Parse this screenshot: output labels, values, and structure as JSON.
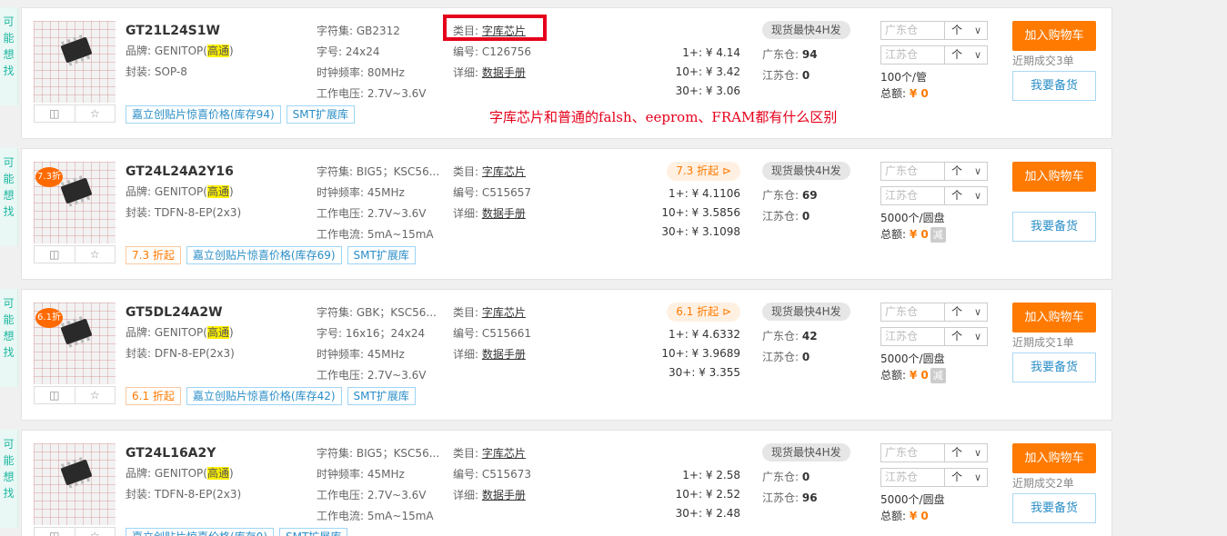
{
  "side_label": [
    "可",
    "能",
    "想",
    "找"
  ],
  "overlay": {
    "note": "字库芯片和普通的falsh、eeprom、FRAM都有什么区别"
  },
  "colors": {
    "accent": "#ff7a00",
    "link": "#2a8ec7",
    "mark": "#e5001b"
  },
  "icons": {
    "compare": "compare-icon",
    "favorite": "star-icon",
    "discount": "tag-icon"
  },
  "products": [
    {
      "name": "GT21L24S1W",
      "brand_label": "品牌: GENITOP(",
      "brand_hl": "高通",
      "brand_end": ")",
      "package": "封装: SOP-8",
      "spec1": "字符集: GB2312",
      "spec2": "字号: 24x24",
      "spec3": "时钟频率: 80MHz",
      "spec4": "工作电压: 2.7V~3.6V",
      "cat_label": "类目:",
      "cat": "字库芯片",
      "code": "编号: C126756",
      "detail_label": "详细:",
      "detail": "数据手册",
      "discount_tag": "",
      "prices": [
        "1+: ¥ 4.14",
        "10+: ¥ 3.42",
        "30+: ¥ 3.06"
      ],
      "fast": "现货最快4H发",
      "gd_label": "广东仓:",
      "gd": "94",
      "js_label": "江苏仓:",
      "js": "0",
      "wh1": "广东仓",
      "wh2": "江苏仓",
      "unit": "个",
      "pack": "100个/管",
      "total_label": "总额:",
      "total": "¥ 0",
      "cart": "加入购物车",
      "recent": "近期成交3单",
      "backup": "我要备货",
      "tag1": "嘉立创贴片惊喜价格(库存94)",
      "tag2": "SMT扩展库"
    },
    {
      "name": "GT24L24A2Y16",
      "brand_label": "品牌: GENITOP(",
      "brand_hl": "高通",
      "brand_end": ")",
      "package": "封装: TDFN-8-EP(2x3)",
      "spec1": "字符集: BIG5；KSC56...",
      "spec2": "时钟频率: 45MHz",
      "spec3": "工作电压: 2.7V~3.6V",
      "spec4": "工作电流: 5mA~15mA",
      "cat_label": "类目:",
      "cat": "字库芯片",
      "code": "编号: C515657",
      "detail_label": "详细:",
      "detail": "数据手册",
      "discount_tag": "7.3 折起",
      "thumb_disc": "7.3折",
      "prices": [
        "1+: ¥ 4.1106",
        "10+: ¥ 3.5856",
        "30+: ¥ 3.1098"
      ],
      "fast": "现货最快4H发",
      "gd_label": "广东仓:",
      "gd": "69",
      "js_label": "江苏仓:",
      "js": "0",
      "wh1": "广东仓",
      "wh2": "江苏仓",
      "unit": "个",
      "pack": "5000个/圆盘",
      "total_label": "总额:",
      "total": "¥ 0",
      "jian": "减",
      "cart": "加入购物车",
      "recent": "",
      "backup": "我要备货",
      "tag0": "7.3 折起",
      "tag1": "嘉立创贴片惊喜价格(库存69)",
      "tag2": "SMT扩展库"
    },
    {
      "name": "GT5DL24A2W",
      "brand_label": "品牌: GENITOP(",
      "brand_hl": "高通",
      "brand_end": ")",
      "package": "封装: DFN-8-EP(2x3)",
      "spec1": "字符集: GBK；KSC56...",
      "spec2": "字号: 16x16；24x24",
      "spec3": "时钟频率: 45MHz",
      "spec4": "工作电压: 2.7V~3.6V",
      "cat_label": "类目:",
      "cat": "字库芯片",
      "code": "编号: C515661",
      "detail_label": "详细:",
      "detail": "数据手册",
      "discount_tag": "6.1 折起",
      "thumb_disc": "6.1折",
      "prices": [
        "1+: ¥ 4.6332",
        "10+: ¥ 3.9689",
        "30+: ¥ 3.355"
      ],
      "fast": "现货最快4H发",
      "gd_label": "广东仓:",
      "gd": "42",
      "js_label": "江苏仓:",
      "js": "0",
      "wh1": "广东仓",
      "wh2": "江苏仓",
      "unit": "个",
      "pack": "5000个/圆盘",
      "total_label": "总额:",
      "total": "¥ 0",
      "jian": "减",
      "cart": "加入购物车",
      "recent": "近期成交1单",
      "backup": "我要备货",
      "tag0": "6.1 折起",
      "tag1": "嘉立创贴片惊喜价格(库存42)",
      "tag2": "SMT扩展库"
    },
    {
      "name": "GT24L16A2Y",
      "brand_label": "品牌: GENITOP(",
      "brand_hl": "高通",
      "brand_end": ")",
      "package": "封装: TDFN-8-EP(2x3)",
      "spec1": "字符集: BIG5；KSC56...",
      "spec2": "时钟频率: 45MHz",
      "spec3": "工作电压: 2.7V~3.6V",
      "spec4": "工作电流: 5mA~15mA",
      "cat_label": "类目:",
      "cat": "字库芯片",
      "code": "编号: C515673",
      "detail_label": "详细:",
      "detail": "数据手册",
      "discount_tag": "",
      "prices": [
        "1+: ¥ 2.58",
        "10+: ¥ 2.52",
        "30+: ¥ 2.48"
      ],
      "fast": "现货最快4H发",
      "gd_label": "广东仓:",
      "gd": "0",
      "js_label": "江苏仓:",
      "js": "96",
      "wh1": "广东仓",
      "wh2": "江苏仓",
      "unit": "个",
      "pack": "5000个/圆盘",
      "total_label": "总额:",
      "total": "¥ 0",
      "cart": "加入购物车",
      "recent": "近期成交2单",
      "backup": "我要备货",
      "tag1": "嘉立创贴片惊喜价格(库存0)",
      "tag2": "SMT扩展库"
    }
  ]
}
